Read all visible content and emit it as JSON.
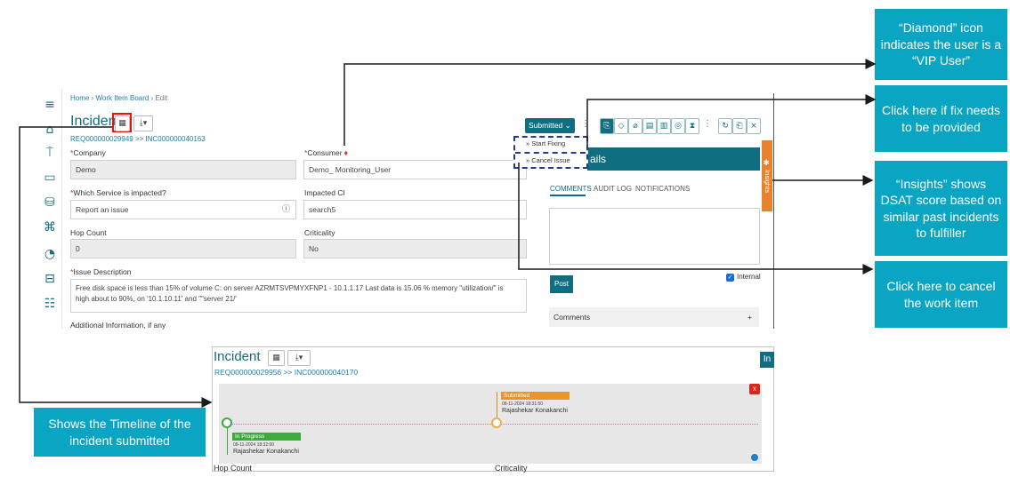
{
  "breadcrumb": {
    "home": "Home",
    "board": "Work Item Board",
    "edit": "Edit"
  },
  "incident": {
    "title": "Incident",
    "req_link": "REQ000000029949 >> INC000000040163"
  },
  "form": {
    "company_label": "Company",
    "company_value": "Demo",
    "consumer_label": "Consumer",
    "consumer_value": "Demo_ Monitoring_User",
    "service_label": "Which Service is impacted?",
    "service_value": "Report an issue",
    "impacted_ci_label": "Impacted CI",
    "impacted_ci_value": "search5",
    "hop_count_label": "Hop Count",
    "hop_count_value": "0",
    "criticality_label": "Criticality",
    "criticality_value": "No",
    "issue_label": "Issue Description",
    "issue_value": "Free disk space is less than 15% of volume C: on server AZRMTSVPMYXFNP1 - 10.1.1.17 Last data is 15.06 % memory \"utilization/\" is high about to 90%, on '10.1.10.11' and \"\"server 21/'",
    "additional_label": "Additional Information, if any"
  },
  "panel": {
    "status_button": "Submitted",
    "menu_start": "Start Fixing",
    "menu_cancel": "Cancel Issue",
    "header_text": "ails",
    "insights": "Insights",
    "tab_comments": "COMMENTS",
    "tab_audit": "AUDIT LOG",
    "tab_notifications": "NOTIFICATIONS",
    "post": "Post",
    "internal": "Internal",
    "comments": "Comments",
    "comments_plus": "+",
    "close": "×"
  },
  "callouts": {
    "diamond": "“Diamond” icon indicates the user is a “VIP User”",
    "fix": "Click here if fix needs to be provided",
    "insights": "“Insights” shows DSAT score based on similar past incidents to fulfiller",
    "cancel": "Click here to cancel the work item",
    "timeline": "Shows the Timeline of the incident submitted"
  },
  "timeline": {
    "title": "Incident",
    "req_link": "REQ000000029956 >> INC000000040170",
    "right_tab": "In",
    "close": "x",
    "submitted": {
      "status": "Submitted",
      "time": "08-11-2024 18:31:50",
      "name": "Rajashekar Konakanchi"
    },
    "in_progress": {
      "status": "In Progress",
      "time": "08-11-2024 18:32:00",
      "name": "Rajashekar Konakanchi"
    },
    "cut_left": "Hop Count",
    "cut_right": "Criticality"
  },
  "colors": {
    "teal": "#0f6e80",
    "callout": "#0aa5c2",
    "insights": "#e8812c",
    "submitted": "#e8952c",
    "in_progress": "#3daa3d"
  }
}
